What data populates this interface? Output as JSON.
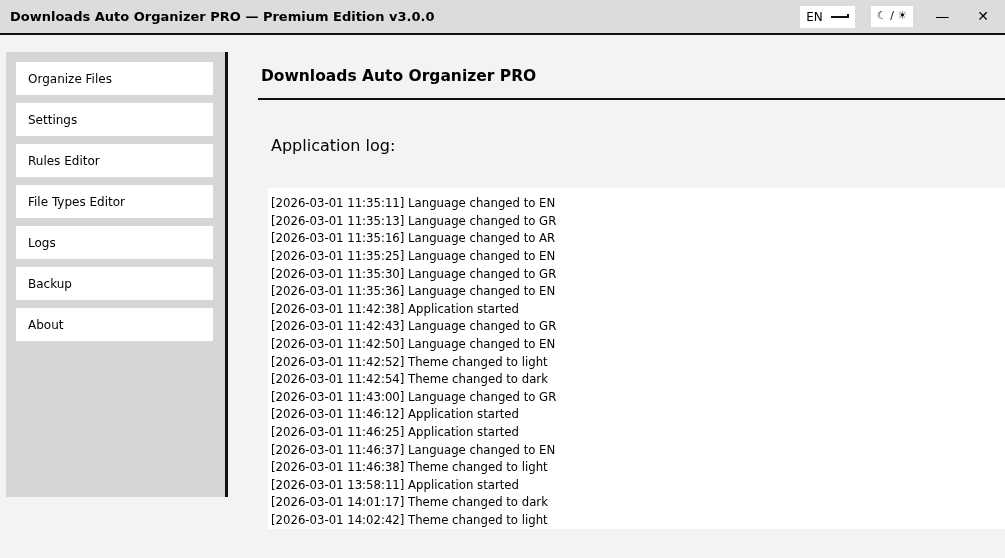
{
  "window": {
    "title": "Downloads Auto Organizer PRO — Premium Edition v3.0.0",
    "language": "EN",
    "theme_toggle": "☾ / ☀",
    "minimize": "—",
    "close": "✕"
  },
  "sidebar": {
    "items": [
      {
        "label": "Organize Files"
      },
      {
        "label": "Settings"
      },
      {
        "label": "Rules Editor"
      },
      {
        "label": "File Types Editor"
      },
      {
        "label": "Logs"
      },
      {
        "label": "Backup"
      },
      {
        "label": "About"
      }
    ]
  },
  "main": {
    "heading": "Downloads Auto Organizer PRO",
    "log_label": "Application log:",
    "log_lines": [
      "[2026-03-01 11:35:11] Language changed to EN",
      "[2026-03-01 11:35:13] Language changed to GR",
      "[2026-03-01 11:35:16] Language changed to AR",
      "[2026-03-01 11:35:25] Language changed to EN",
      "[2026-03-01 11:35:30] Language changed to GR",
      "[2026-03-01 11:35:36] Language changed to EN",
      "[2026-03-01 11:42:38] Application started",
      "[2026-03-01 11:42:43] Language changed to GR",
      "[2026-03-01 11:42:50] Language changed to EN",
      "[2026-03-01 11:42:52] Theme changed to light",
      "[2026-03-01 11:42:54] Theme changed to dark",
      "[2026-03-01 11:43:00] Language changed to GR",
      "[2026-03-01 11:46:12] Application started",
      "[2026-03-01 11:46:25] Application started",
      "[2026-03-01 11:46:37] Language changed to EN",
      "[2026-03-01 11:46:38] Theme changed to light",
      "[2026-03-01 13:58:11] Application started",
      "[2026-03-01 14:01:17] Theme changed to dark",
      "[2026-03-01 14:02:42] Theme changed to light"
    ]
  }
}
